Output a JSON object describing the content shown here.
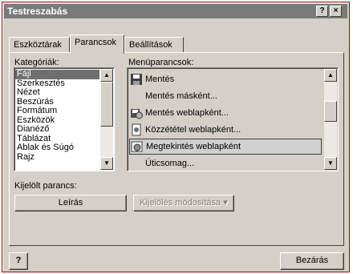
{
  "window": {
    "title": "Testreszabás",
    "help_btn": "?",
    "close_btn": "×"
  },
  "tabs": [
    {
      "label": "Eszköztárak"
    },
    {
      "label": "Parancsok"
    },
    {
      "label": "Beállítások"
    }
  ],
  "categories": {
    "label": "Kategóriák:",
    "items": [
      "Fájl",
      "Szerkesztés",
      "Nézet",
      "Beszúrás",
      "Formátum",
      "Eszközök",
      "Dianéző",
      "Táblázat",
      "Ablak és Súgó",
      "Rajz"
    ],
    "selected": "Fájl"
  },
  "commands": {
    "label": "Menüparancsok:",
    "items": [
      {
        "label": "Mentés",
        "icon": "save-icon"
      },
      {
        "label": "Mentés másként...",
        "icon": ""
      },
      {
        "label": "Mentés weblapként...",
        "icon": "save-web-icon"
      },
      {
        "label": "Közzététel weblapként...",
        "icon": "publish-web-icon"
      },
      {
        "label": "Megtekintés weblapként",
        "icon": "web-preview-icon"
      },
      {
        "label": "Úticsomag...",
        "icon": ""
      }
    ],
    "selected": "Megtekintés weblapként"
  },
  "selected_command": {
    "label": "Kijelölt parancs:",
    "description_btn": "Leírás",
    "modify_btn": "Kijelölés módosítása ▾"
  },
  "footer": {
    "help_icon": "?",
    "close_btn": "Bezárás"
  },
  "colors": {
    "title_bar": "#7a7a7a",
    "dialog_face": "#d4d0c8",
    "selection": "#6f6f6f",
    "frame_border": "#a00000"
  }
}
